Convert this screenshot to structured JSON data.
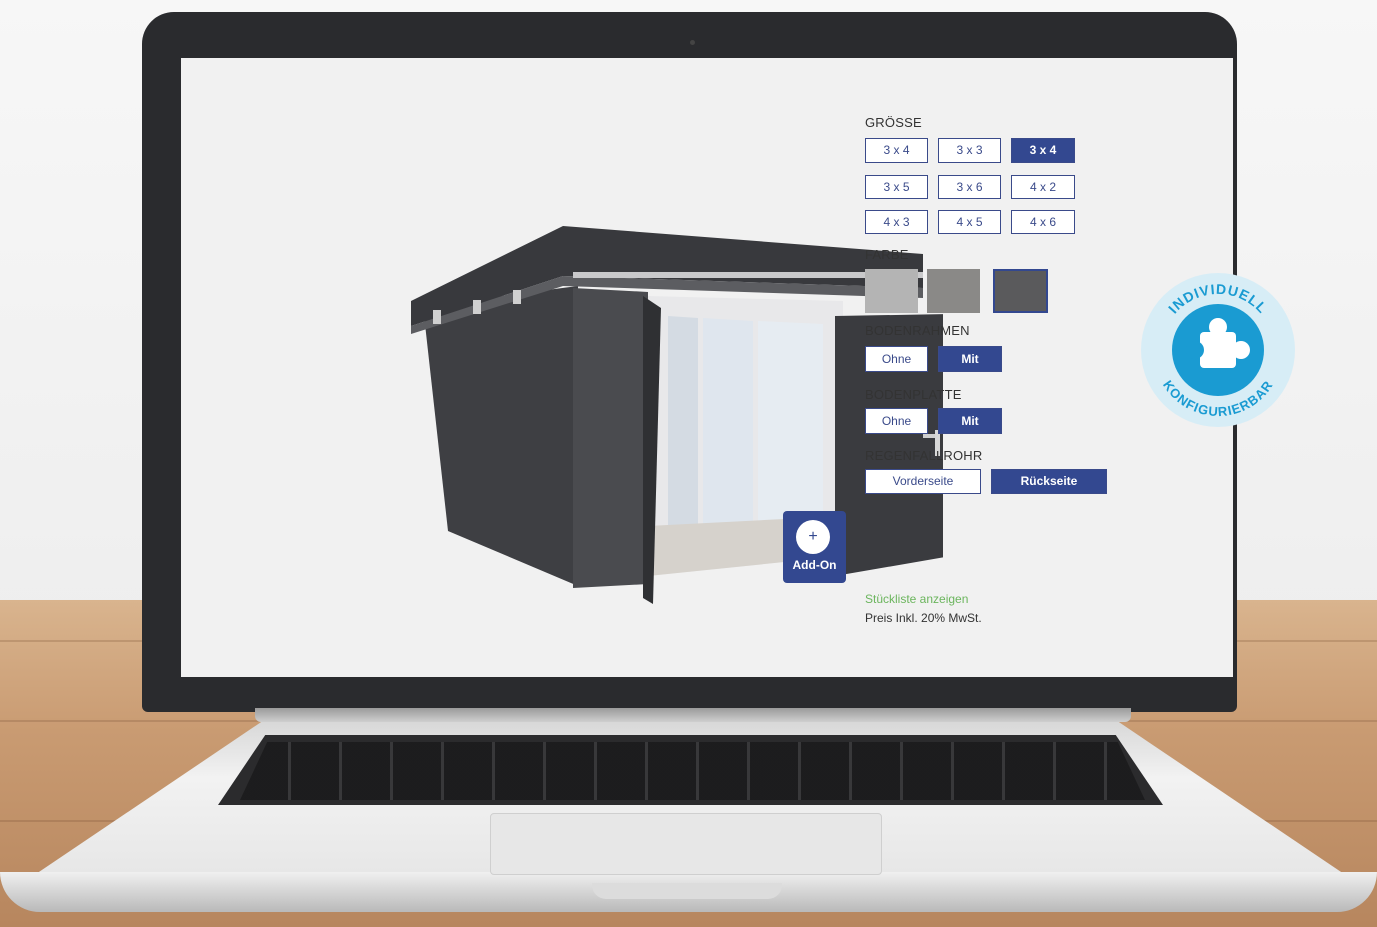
{
  "groesse": {
    "label": "GRÖSSE",
    "options": [
      "3 x 4",
      "3 x 3",
      "3 x 4",
      "3 x 5",
      "3 x 6",
      "4 x 2",
      "4 x 3",
      "4 x 5",
      "4 x 6"
    ],
    "selected_index": 2
  },
  "farbe": {
    "label": "FARBE",
    "swatches": [
      {
        "color": "#b4b4b4"
      },
      {
        "color": "#8a8987"
      },
      {
        "color": "#5a5a5c"
      }
    ],
    "selected_index": 2
  },
  "bodenrahmen": {
    "label": "BODENRAHMEN",
    "options": [
      "Ohne",
      "Mit"
    ],
    "selected_index": 1
  },
  "bodenplatte": {
    "label": "BODENPLATTE",
    "options": [
      "Ohne",
      "Mit"
    ],
    "selected_index": 1
  },
  "regenfallrohr": {
    "label": "REGENFALLROHR",
    "options": [
      "Vorderseite",
      "Rückseite"
    ],
    "selected_index": 1
  },
  "addon": {
    "icon": "plus-icon",
    "symbol": "+",
    "label": "Add-On"
  },
  "links": {
    "stueckliste": "Stückliste anzeigen"
  },
  "price_note": "Preis Inkl. 20% MwSt.",
  "badge": {
    "top_text": "INDIVIDUELL",
    "bottom_text": "KONFIGURIERBAR",
    "icon": "puzzle-icon"
  },
  "colors": {
    "accent": "#334890",
    "link_green": "#6bb55d",
    "badge_blue": "#1a9bd2"
  }
}
